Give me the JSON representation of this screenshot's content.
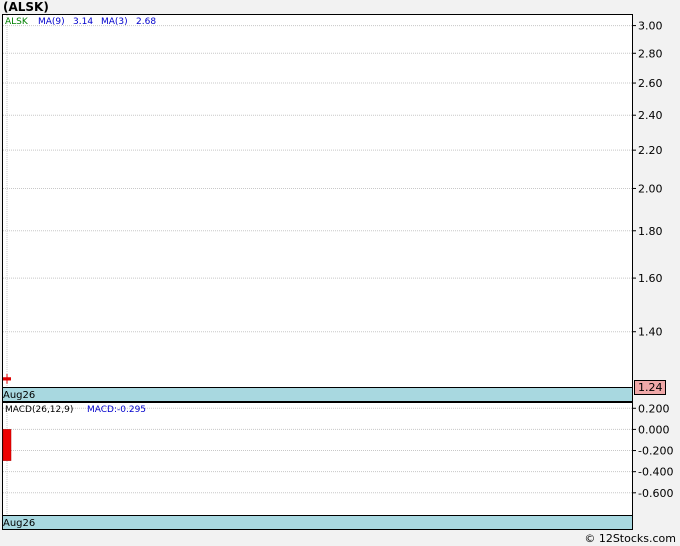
{
  "title": "(ALSK)",
  "price_panel": {
    "symbol": "ALSK",
    "ma9_label": "MA(9)",
    "ma9_value": "3.14",
    "ma3_label": "MA(3)",
    "ma3_value": "2.68",
    "date_label": "Aug26",
    "last_price_label": "1.24"
  },
  "macd_panel": {
    "label": "MACD(26,12,9)",
    "value_label": "MACD:-0.295",
    "date_label": "Aug26"
  },
  "watermark": "© 12Stocks.com",
  "colors": {
    "symbol": "#008000",
    "indicator_text": "#0000cc",
    "date_band": "#a8d8e0",
    "last_price_box": "#f0a8a8",
    "candle": "#dd0000",
    "grid": "#c8c8c8"
  },
  "chart_data": [
    {
      "type": "candlestick",
      "panel": "price",
      "y_ticks": [
        3.0,
        2.8,
        2.6,
        2.4,
        2.2,
        2.0,
        1.8,
        1.6,
        1.4
      ],
      "y_tick_labels": [
        "3.00",
        "2.80",
        "2.60",
        "2.40",
        "2.20",
        "2.00",
        "1.80",
        "1.60",
        "1.40"
      ],
      "ylim": [
        1.22,
        3.08
      ],
      "x_labels": [
        "Aug26"
      ],
      "scale": "log",
      "candles": [
        {
          "date": "Aug26",
          "open": 1.25,
          "close": 1.24,
          "high": 1.26,
          "low": 1.23
        }
      ],
      "ma9": 3.14,
      "ma3": 2.68,
      "last_price": 1.24,
      "grid": true
    },
    {
      "type": "bar",
      "panel": "macd",
      "y_ticks": [
        0.2,
        0.0,
        -0.2,
        -0.4,
        -0.6
      ],
      "y_tick_labels": [
        "0.200",
        "0.000",
        "-0.200",
        "-0.400",
        "-0.600"
      ],
      "ylim": [
        -0.81,
        0.25
      ],
      "categories": [
        "Aug26"
      ],
      "values": [
        -0.295
      ],
      "grid": true
    }
  ]
}
